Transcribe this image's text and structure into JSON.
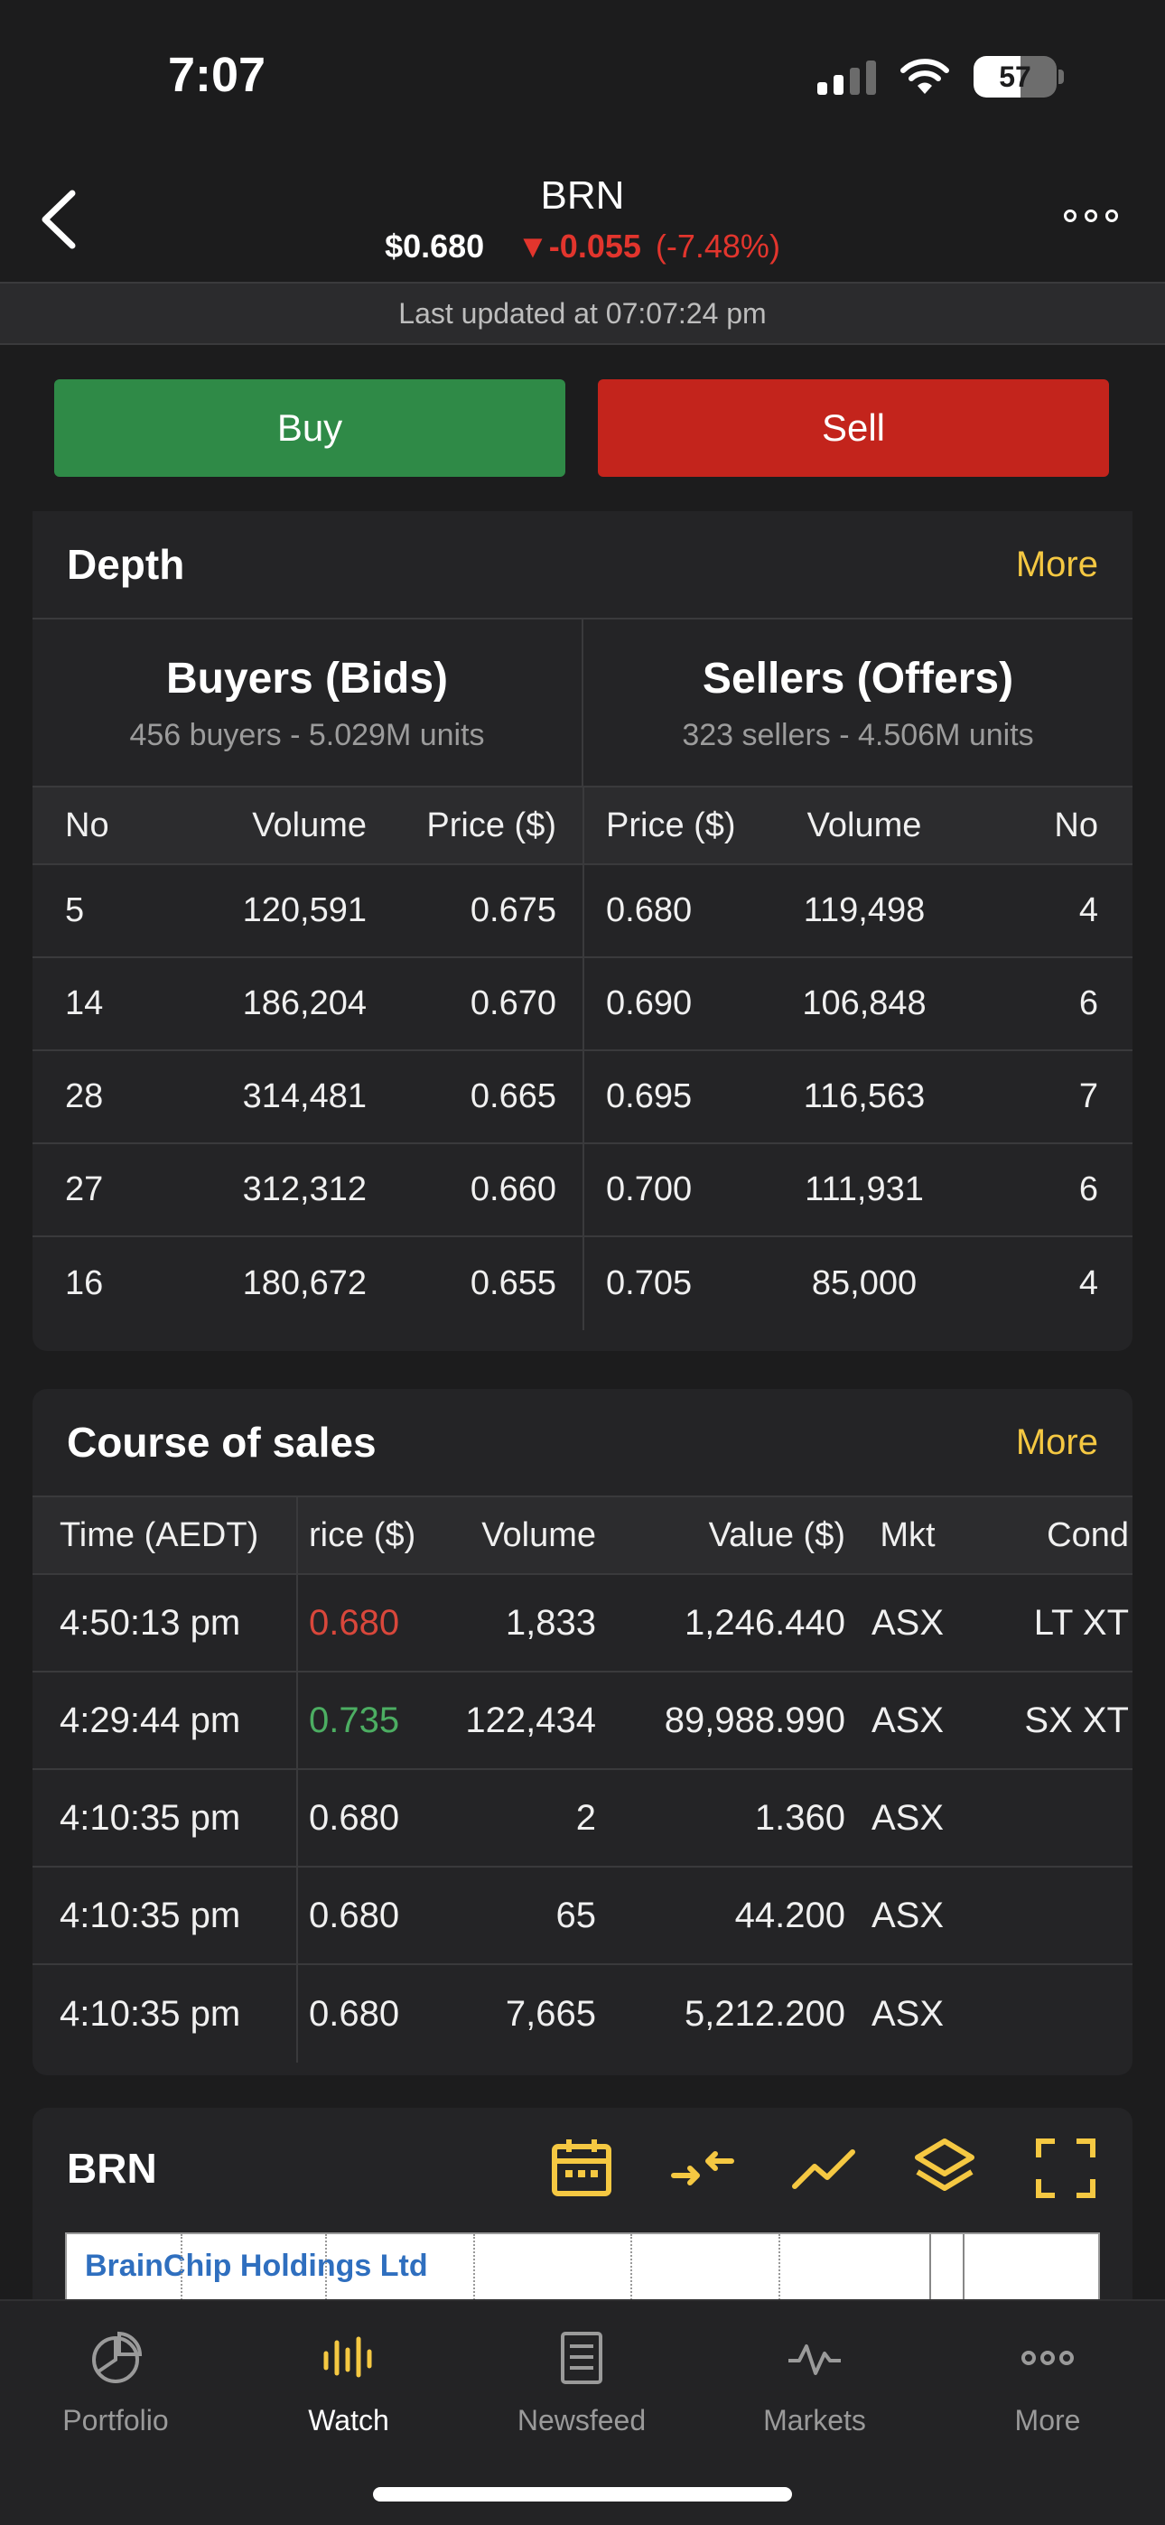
{
  "status": {
    "time": "7:07",
    "battery": "57"
  },
  "header": {
    "symbol": "BRN",
    "price": "$0.680",
    "change": "▼-0.055",
    "change_pct": "(-7.48%)",
    "last_updated": "Last updated at 07:07:24 pm"
  },
  "actions": {
    "buy": "Buy",
    "sell": "Sell"
  },
  "depth": {
    "title": "Depth",
    "more": "More",
    "buyers_title": "Buyers (Bids)",
    "buyers_sub": "456 buyers - 5.029M units",
    "sellers_title": "Sellers (Offers)",
    "sellers_sub": "323 sellers - 4.506M units",
    "headers": {
      "no": "No",
      "volume": "Volume",
      "price": "Price ($)"
    },
    "rows": [
      {
        "bid_no": "5",
        "bid_vol": "120,591",
        "bid_price": "0.675",
        "ask_price": "0.680",
        "ask_vol": "119,498",
        "ask_no": "4"
      },
      {
        "bid_no": "14",
        "bid_vol": "186,204",
        "bid_price": "0.670",
        "ask_price": "0.690",
        "ask_vol": "106,848",
        "ask_no": "6"
      },
      {
        "bid_no": "28",
        "bid_vol": "314,481",
        "bid_price": "0.665",
        "ask_price": "0.695",
        "ask_vol": "116,563",
        "ask_no": "7"
      },
      {
        "bid_no": "27",
        "bid_vol": "312,312",
        "bid_price": "0.660",
        "ask_price": "0.700",
        "ask_vol": "111,931",
        "ask_no": "6"
      },
      {
        "bid_no": "16",
        "bid_vol": "180,672",
        "bid_price": "0.655",
        "ask_price": "0.705",
        "ask_vol": "85,000",
        "ask_no": "4"
      }
    ]
  },
  "course_of_sales": {
    "title": "Course of sales",
    "more": "More",
    "headers": {
      "time": "Time (AEDT)",
      "price": "rice ($)",
      "volume": "Volume",
      "value": "Value ($)",
      "mkt": "Mkt",
      "cond": "Cond"
    },
    "rows": [
      {
        "time": "4:50:13 pm",
        "price": "0.680",
        "volume": "1,833",
        "value": "1,246.440",
        "mkt": "ASX",
        "cond": "LT XT",
        "price_color": "red"
      },
      {
        "time": "4:29:44 pm",
        "price": "0.735",
        "volume": "122,434",
        "value": "89,988.990",
        "mkt": "ASX",
        "cond": "SX XT",
        "price_color": "green"
      },
      {
        "time": "4:10:35 pm",
        "price": "0.680",
        "volume": "2",
        "value": "1.360",
        "mkt": "ASX",
        "cond": ""
      },
      {
        "time": "4:10:35 pm",
        "price": "0.680",
        "volume": "65",
        "value": "44.200",
        "mkt": "ASX",
        "cond": ""
      },
      {
        "time": "4:10:35 pm",
        "price": "0.680",
        "volume": "7,665",
        "value": "5,212.200",
        "mkt": "ASX",
        "cond": ""
      }
    ]
  },
  "chart": {
    "symbol": "BRN",
    "company": "BrainChip Holdings Ltd",
    "tools": [
      "calendar-icon",
      "compare-icon",
      "trend-line-icon",
      "layers-icon",
      "fullscreen-icon"
    ]
  },
  "tabs": [
    {
      "label": "Portfolio",
      "icon": "portfolio-icon"
    },
    {
      "label": "Watch",
      "icon": "watch-icon"
    },
    {
      "label": "Newsfeed",
      "icon": "newsfeed-icon"
    },
    {
      "label": "Markets",
      "icon": "markets-icon"
    },
    {
      "label": "More",
      "icon": "more-icon"
    }
  ],
  "colors": {
    "accent": "#f5c842",
    "buy": "#2f8a47",
    "sell": "#c3241c",
    "negative": "#e2352d",
    "positive": "#4cae62"
  }
}
